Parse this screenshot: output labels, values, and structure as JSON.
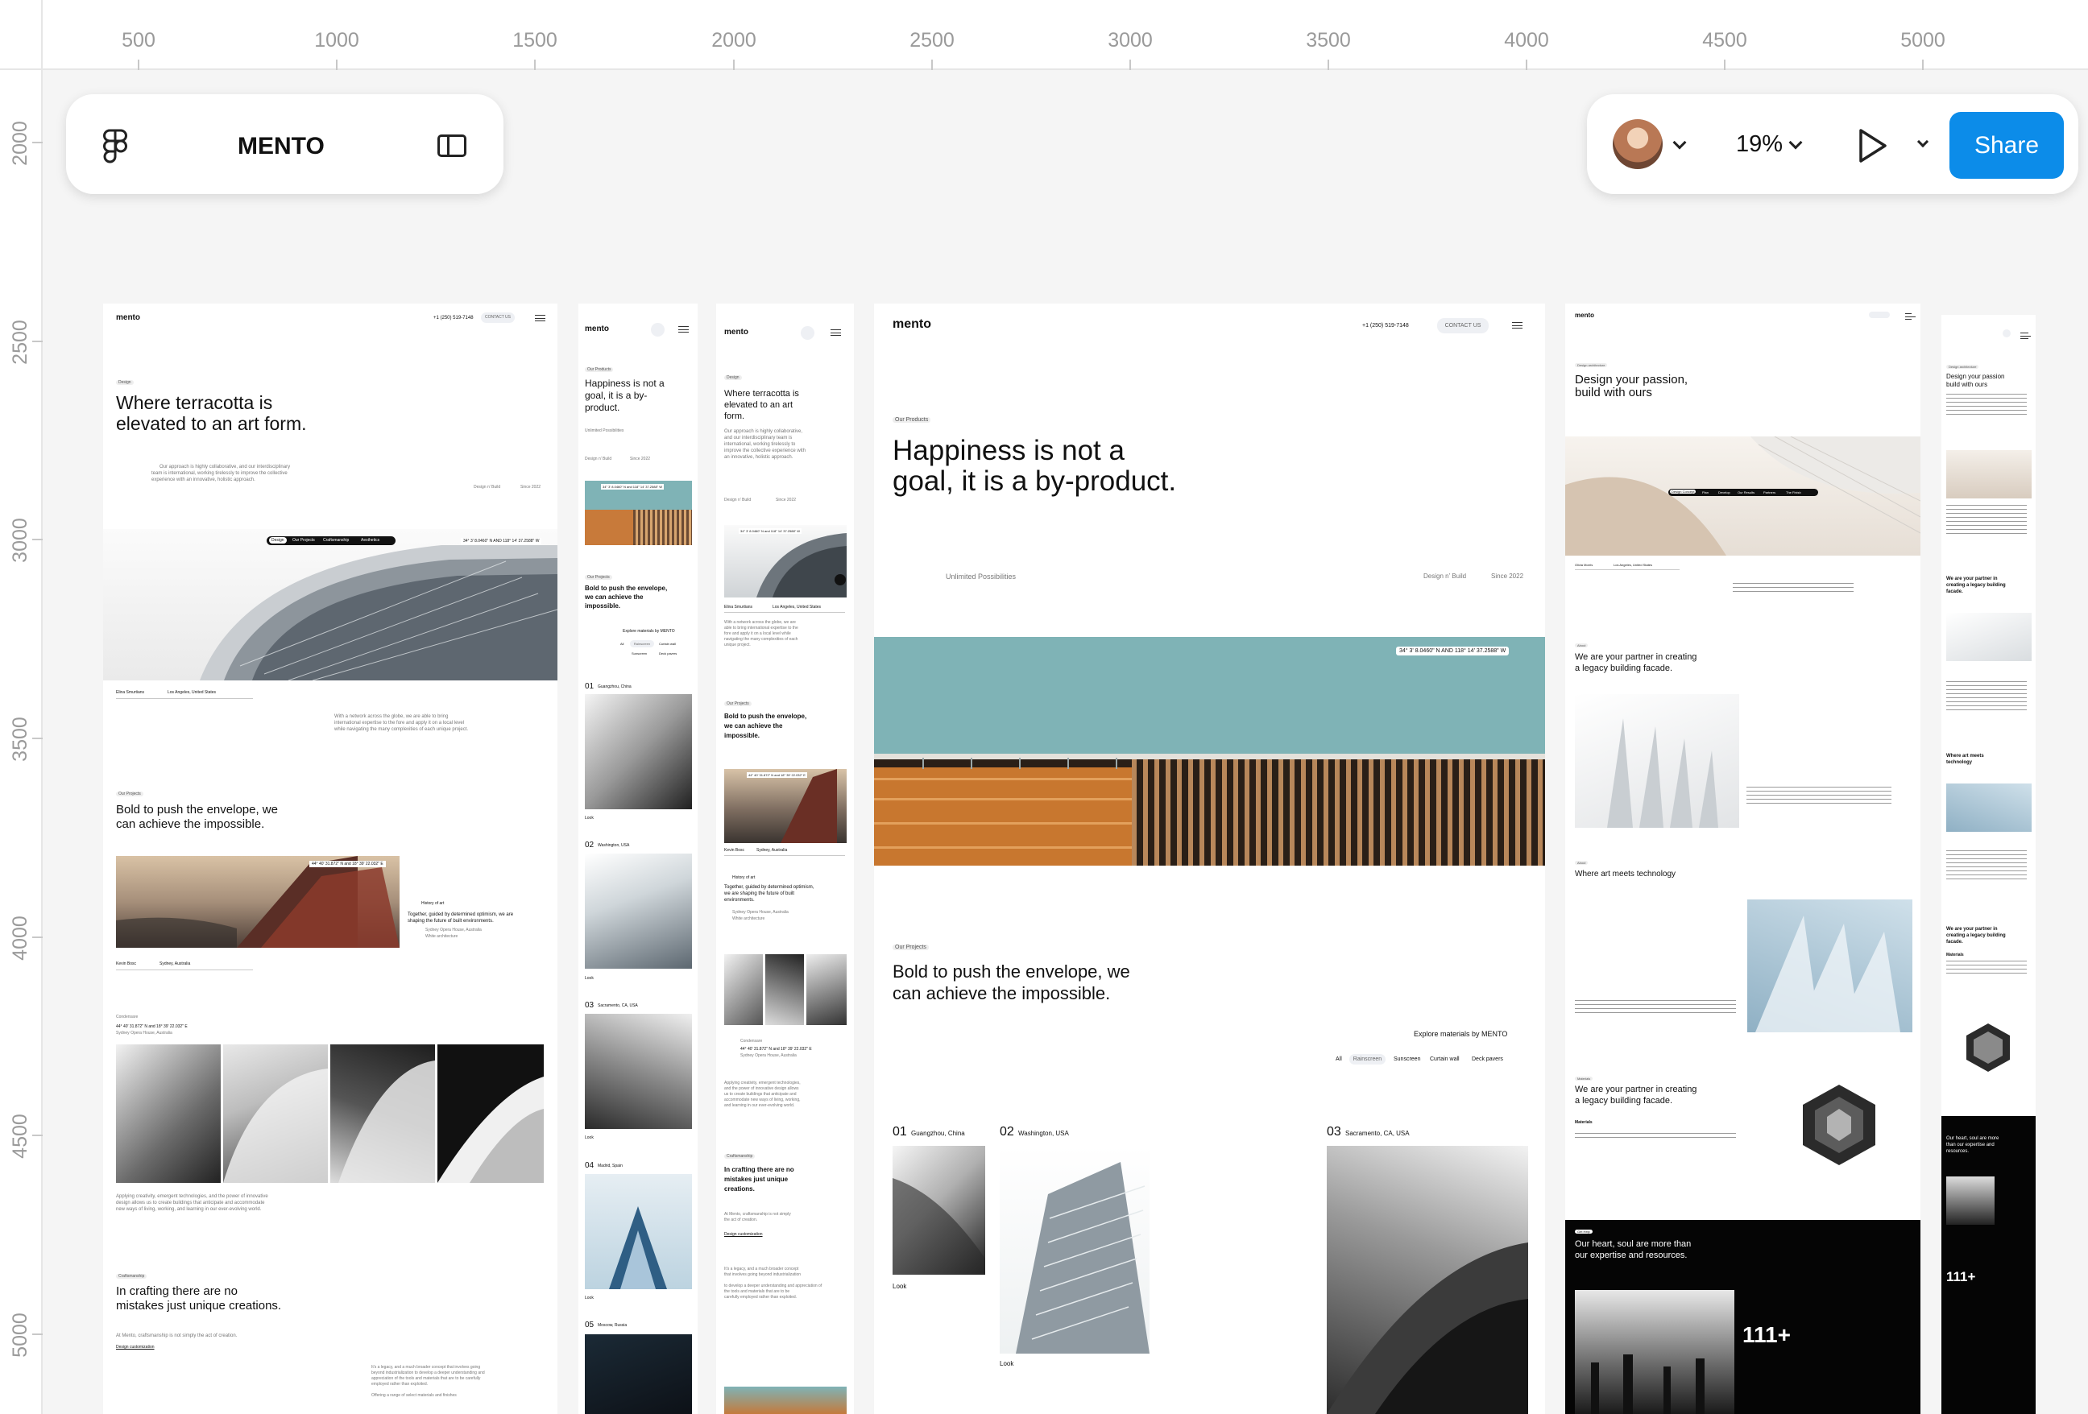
{
  "ruler": {
    "x_labels": [
      "500",
      "1000",
      "1500",
      "2000",
      "2500",
      "3000",
      "3500",
      "4000",
      "4500",
      "5000"
    ],
    "y_labels": [
      "2000",
      "2500",
      "3000",
      "3500",
      "4000",
      "4500",
      "5000"
    ]
  },
  "file_panel": {
    "title": "MENTO",
    "logo_icon": "figma-logo-icon",
    "toggle_icon": "sidebar-panel-icon"
  },
  "toolbar": {
    "zoom": "19%",
    "share_label": "Share",
    "accent": "#0c8ce9",
    "play_icon": "play-icon",
    "avatar": "user-avatar"
  },
  "frame1": {
    "logo": "mento",
    "phone": "+1 (250) 519-7148",
    "contact": "CONTACT US",
    "tag_design": "Design",
    "hero_title_1": "Where terracotta is",
    "hero_title_2": "elevated to an art form.",
    "intro_1": "Our approach is highly collaborative, and our interdisciplinary",
    "intro_2": "team is international, working tirelessly to improve the collective",
    "intro_3": "experience with an innovative, holistic approach.",
    "design_build": "Design n’ Build",
    "since": "Since 2022",
    "tabs": [
      "Design",
      "Our Projects",
      "Craftsmanship",
      "Aesthetics"
    ],
    "coords": "34° 3' 8.0460\" N AND 118° 14' 37.2588\" W",
    "author": "Elina Smurtians",
    "location": "Los Angeles, United States",
    "body_1": "With a network across the globe, we are able to bring",
    "body_2": "international expertise to the fore and apply it on a local level",
    "body_3": "while navigating the many complexities of each unique project.",
    "tag_projects": "Our Projects",
    "projects_title_1": "Bold to push the envelope, we",
    "projects_title_2": "can achieve the impossible.",
    "coords2": "44° 40' 31.872\" N and 18° 39' 22.032\" E",
    "history": "History of art",
    "together_1": "Together, guided by determined optimism, we are",
    "together_2": "shaping the future of built environments.",
    "sydney": "Sydney Opera House, Australia",
    "white_arch": "White architecture",
    "kevin": "Kevin Bosc",
    "kevin_loc": "Sydney, Australia",
    "craft_label": "Condensare",
    "craft_coords_1": "44° 40' 31.872\" N and 18° 39' 22.032\" E",
    "craft_coords_2": "Sydney Opera House, Australia",
    "apply_1": "Applying creativity, emergent technologies, and the power of innovative",
    "apply_2": "design allows us to create buildings that anticipate and accommodate",
    "apply_3": "new ways of living, working, and learning in our ever-evolving world.",
    "tag_craft": "Craftsmanship",
    "craft_title_1": "In crafting there are no",
    "craft_title_2": "mistakes just unique creations.",
    "craft_body": "At Mento, craftsmanship is not simply the act of creation.",
    "craft_link": "Design customization",
    "legacy_1": "It's a legacy, and a much broader concept that involves going",
    "legacy_2": "beyond industrialization to develop a deeper understanding and",
    "legacy_3": "appreciation of the tools and materials that are to be carefully",
    "legacy_4": "employed rather than exploited.",
    "offering": "Offering a range of select materials and finishes"
  },
  "frame2": {
    "logo": "mento",
    "tag": "Our Products",
    "title_1": "Happiness is not a",
    "title_2": "goal, it is a by-",
    "title_3": "product.",
    "unlimited": "Unlimited Possibilities",
    "design_build": "Design n’ Build",
    "since": "Since 2022",
    "coords": "34° 3' 8.0460\" N and 118° 14' 37.2588\" W",
    "tag_projects": "Our Projects",
    "bold_1": "Bold to push the envelope,",
    "bold_2": "we can achieve the",
    "bold_3": "impossible.",
    "explore": "Explore materials by MENTO",
    "chips": [
      "All",
      "Rainscreen",
      "Curtain wall",
      "Sunscreen",
      "Deck pavers"
    ],
    "p1": "01",
    "p1_loc": "Guangzhou, China",
    "p2": "02",
    "p2_loc": "Washington, USA",
    "p3": "03",
    "p3_loc": "Sacramento, CA, USA",
    "p4": "04",
    "p4_loc": "Madrid, Spain",
    "p5": "05",
    "p5_loc": "Moscow, Russia",
    "look": "Look"
  },
  "frame3": {
    "logo": "mento",
    "tag": "Design",
    "title_1": "Where terracotta is",
    "title_2": "elevated to an art",
    "title_3": "form.",
    "intro_1": "Our approach is highly collaborative,",
    "intro_2": "and our interdisciplinary team is",
    "intro_3": "international, working tirelessly to",
    "intro_4": "improve the collective experience with",
    "intro_5": "an innovative, holistic approach.",
    "design_build": "Design n’ Build",
    "since": "Since 2022",
    "coords": "34° 3' 8.0460\" N and 118° 14' 37.2588\" W",
    "author": "Elina Smurtians",
    "location": "Los Angeles, United States",
    "network_1": "With a network across the globe, we are",
    "network_2": "able to bring international expertise to the",
    "network_3": "fore and apply it on a local level while",
    "network_4": "navigating the many complexities of each",
    "network_5": "unique project.",
    "tag_projects": "Our Projects",
    "bold_1": "Bold to push the envelope,",
    "bold_2": "we can achieve the",
    "bold_3": "impossible.",
    "coords2": "44° 40' 31.872\" N and 18° 39' 22.032\" E",
    "kevin": "Kevin Bosc",
    "kevin_loc": "Sydney, Australia",
    "history": "History of art",
    "together_1": "Together, guided by determined optimism,",
    "together_2": "we are shaping the future of built",
    "together_3": "environments.",
    "sydney": "Sydney Opera House, Australia",
    "white": "White architecture",
    "condensare": "Condensare",
    "c_coords_1": "44° 40' 31.872\" N and 18° 39' 22.032\" E",
    "c_coords_2": "Sydney Opera House, Australia",
    "apply_1": "Applying creativity, emergent technologies,",
    "apply_2": "and the power of innovative design allows",
    "apply_3": "us to create buildings that anticipate and",
    "apply_4": "accommodate new ways of living, working,",
    "apply_5": "and learning in our ever-evolving world.",
    "tag_craft": "Craftsmanship",
    "craft_1": "In crafting there are no",
    "craft_2": "mistakes just unique",
    "craft_3": "creations.",
    "at_mento_1": "At Mento, craftsmanship is not simply",
    "at_mento_2": "the act of creation.",
    "craft_link": "Design customization",
    "legacy_1": "It's a legacy, and a much broader concept",
    "legacy_2": "that involves going beyond industrialization",
    "legacy_3": "to develop a deeper understanding and appreciation of",
    "legacy_4": "the tools and materials that are to be",
    "legacy_5": "carefully employed rather than exploited."
  },
  "frame4": {
    "logo": "mento",
    "phone": "+1 (250) 519-7148",
    "contact": "CONTACT US",
    "tag": "Our Products",
    "title_1": "Happiness is not a",
    "title_2": "goal, it is a by-product.",
    "unlimited": "Unlimited Possibilities",
    "design_build": "Design n’ Build",
    "since": "Since 2022",
    "coords": "34° 3' 8.0460\" N AND 118° 14' 37.2588\" W",
    "tag_projects": "Our Projects",
    "bold_1": "Bold to push the envelope, we",
    "bold_2": "can achieve the impossible.",
    "explore": "Explore materials by MENTO",
    "chips": [
      "All",
      "Rainscreen",
      "Sunscreen",
      "Curtain wall",
      "Deck pavers"
    ],
    "p1": "01",
    "p1_loc": "Guangzhou, China",
    "p2": "02",
    "p2_loc": "Washington, USA",
    "p3": "03",
    "p3_loc": "Sacramento, CA, USA",
    "look": "Look"
  },
  "frame5": {
    "logo": "mento",
    "tag": "Design architecture",
    "title_1": "Design your passion,",
    "title_2": "build with ours",
    "chips": [
      "Design Concept",
      "Plan",
      "Develop",
      "Our Results",
      "Partners",
      "The Finish"
    ],
    "author": "Olivia Morris",
    "author_loc": "Los Angeles, United States",
    "partner_tag": "About",
    "partner_1": "We are your partner in creating",
    "partner_2": "a legacy building facade.",
    "art_tag": "About",
    "art": "Where art meets technology",
    "partner2_tag": "Materials",
    "partner2_1": "We are your partner in creating",
    "partner2_2": "a legacy building facade.",
    "materials": "Materials",
    "heart_tag": "Get Help",
    "heart_1": "Our heart, soul are more than",
    "heart_2": "our expertise and resources.",
    "big_number": "111+"
  },
  "frame6": {
    "tag": "Design architecture",
    "title_1": "Design your passion",
    "title_2": "build with ours",
    "partner_1": "We are your partner in",
    "partner_2": "creating a legacy building",
    "partner_3": "facade.",
    "art_1": "Where art meets",
    "art_2": "technology",
    "partner2_1": "We are your partner in",
    "partner2_2": "creating a legacy building",
    "partner2_3": "facade.",
    "materials": "Materials",
    "heart_1": "Our heart, soul are more",
    "heart_2": "than our expertise and",
    "heart_3": "resources.",
    "big_number": "111+"
  }
}
